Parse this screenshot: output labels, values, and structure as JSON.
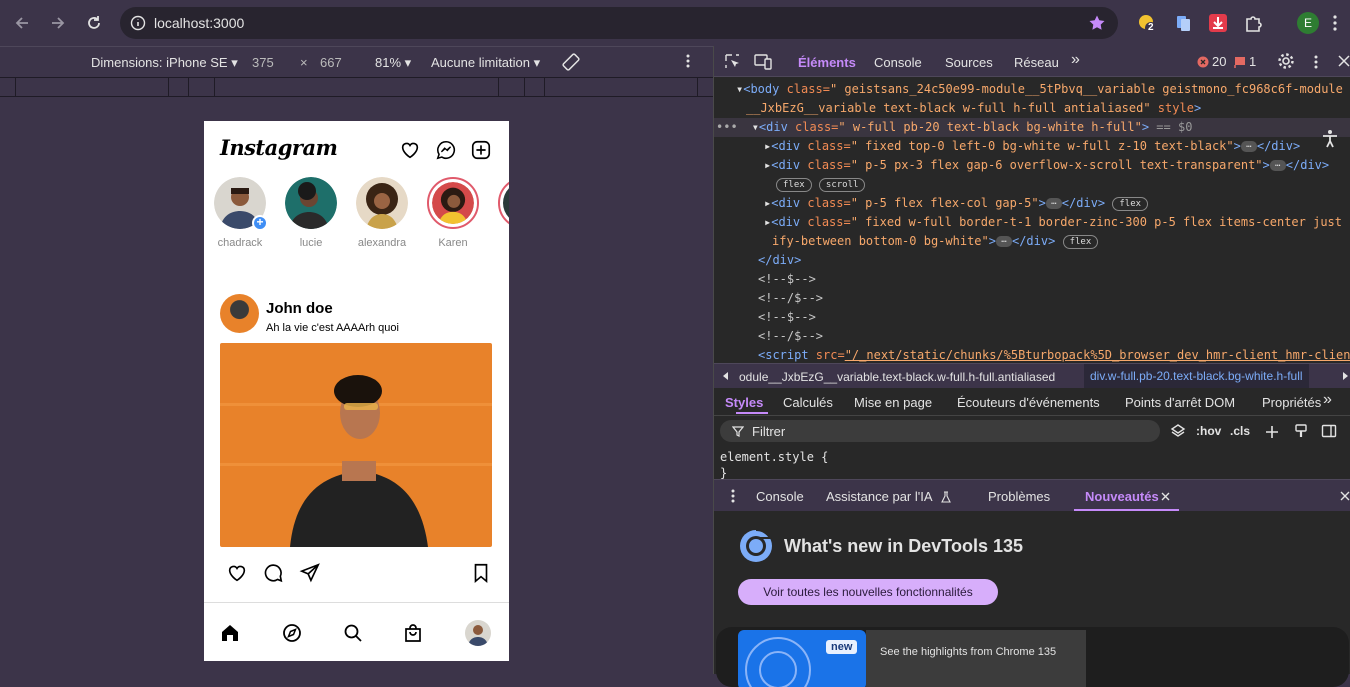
{
  "browser": {
    "url": "localhost:3000",
    "profile_initial": "E",
    "extension_badge": "2"
  },
  "emulation": {
    "device": "Dimensions: iPhone SE",
    "width": "375",
    "times": "×",
    "height": "667",
    "zoom": "81%",
    "throttle": "Aucune limitation"
  },
  "app": {
    "logo": "Instagram",
    "stories": [
      {
        "name": "chadrack"
      },
      {
        "name": "lucie"
      },
      {
        "name": "alexandra"
      },
      {
        "name": "Karen"
      }
    ],
    "post": {
      "author": "John doe",
      "caption": "Ah la vie c'est AAAArh quoi"
    },
    "plus_glyph": "+"
  },
  "devtools": {
    "tabs": [
      "Éléments",
      "Console",
      "Sources",
      "Réseau"
    ],
    "more_tabs": "»",
    "errors": "20",
    "warnings": "1",
    "elements": {
      "l1_tag": "<body",
      "l1_attr": " class=",
      "l1_val": "\" geistsans_24c50e99-module__5tPbvq__variable geistmono_fc968c6f-module",
      "l2_val": "__JxbEzG__variable text-black  w-full h-full antialiased\"",
      "l2_attr": " style",
      "l2_end": ">",
      "l3_dots": "•••",
      "l3_tag": "<div",
      "l3_attr": " class=",
      "l3_val": "\" w-full pb-20 text-black  bg-white h-full\"",
      "l3_end": ">",
      "l3_eq": " == $0",
      "l4_tag": "<div",
      "l4_attr": " class=",
      "l4_val": "\" fixed top-0 left-0 bg-white w-full z-10 text-black\"",
      "l4_end": ">",
      "l4_close": "</div>",
      "l5_tag": "<div",
      "l5_attr": " class=",
      "l5_val": "\" p-5 px-3 flex gap-6 overflow-x-scroll text-transparent\"",
      "l5_end": ">",
      "l5_close": "</div>",
      "pill_flex": "flex",
      "pill_scroll": "scroll",
      "l7_tag": "<div",
      "l7_attr": " class=",
      "l7_val": "\" p-5 flex flex-col gap-5\"",
      "l7_end": ">",
      "l7_close": "</div>",
      "l8_tag": "<div",
      "l8_attr": " class=",
      "l8_val": "\" fixed w-full border-t-1 border-zinc-300 p-5 flex items-center just",
      "l9_val": "ify-between bottom-0 bg-white\"",
      "l9_end": ">",
      "l9_close": "</div>",
      "l10": "</div>",
      "c1": "<!--$-->",
      "c2": "<!--/$-->",
      "c3": "<!--$-->",
      "c4": "<!--/$-->",
      "l15_tag": "<script",
      "l15_attr": " src=",
      "l15_val": "\"/_next/static/chunks/%5Bturbopack%5D_browser_dev_hmr-client_hmr-clien",
      "ellipsis": "…"
    },
    "crumbs": [
      "odule__JxbEzG__variable.text-black.w-full.h-full.antialiased",
      "div.w-full.pb-20.text-black.bg-white.h-full"
    ],
    "style_tabs": [
      "Styles",
      "Calculés",
      "Mise en page",
      "Écouteurs d'événements",
      "Points d'arrêt DOM",
      "Propriétés"
    ],
    "filter_placeholder": "Filtrer",
    "hov": ":hov",
    "cls": ".cls",
    "element_style": "element.style {",
    "element_style_close": "}",
    "drawer_tabs": [
      "Console",
      "Assistance par l'IA",
      "Problèmes",
      "Nouveautés"
    ],
    "whats_new_title": "What's new in DevTools 135",
    "whats_new_button": "Voir toutes les nouvelles fonctionnalités",
    "card_badge": "new",
    "card_text": "See the highlights from Chrome 135"
  },
  "colors": {
    "accent": "#c58af9",
    "story_ring": "#e05a6b",
    "plus_badge": "#3f8ef5",
    "post_bg": "#e8822a"
  }
}
